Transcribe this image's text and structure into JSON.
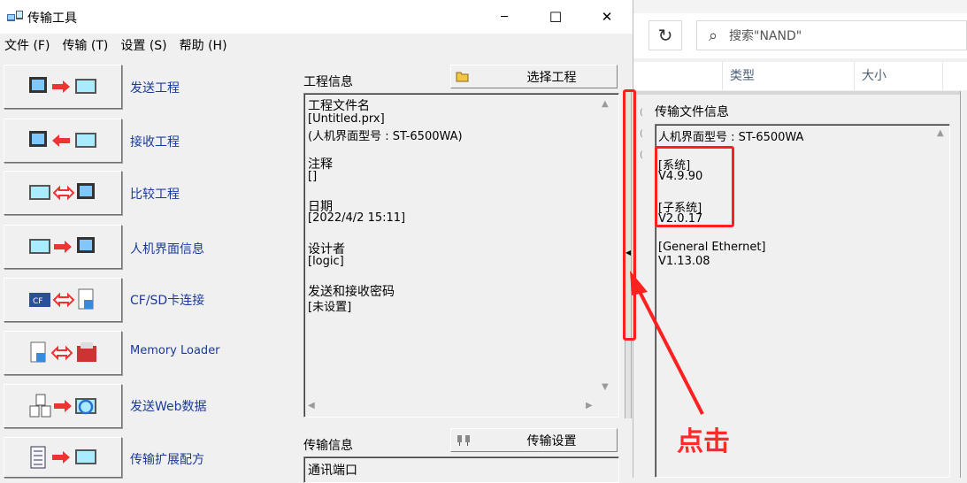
{
  "window": {
    "title": "传输工具",
    "minimize": "─",
    "maximize": "☐",
    "close": "✕"
  },
  "menu": [
    {
      "label": "文件 (F)"
    },
    {
      "label": "传输 (T)"
    },
    {
      "label": "设置 (S)"
    },
    {
      "label": "帮助 (H)"
    }
  ],
  "transfer_buttons": [
    {
      "label": "发送工程",
      "icon": "send-project-icon"
    },
    {
      "label": "接收工程",
      "icon": "receive-project-icon"
    },
    {
      "label": "比较工程",
      "icon": "compare-project-icon"
    },
    {
      "label": "人机界面信息",
      "icon": "hmi-info-icon"
    },
    {
      "label": "CF/SD卡连接",
      "icon": "cf-sd-card-icon"
    },
    {
      "label": "Memory Loader",
      "icon": "memory-loader-icon"
    },
    {
      "label": "发送Web数据",
      "icon": "send-web-data-icon"
    },
    {
      "label": "传输扩展配方",
      "icon": "transfer-recipe-icon"
    }
  ],
  "project_info": {
    "label": "工程信息",
    "select_button": "选择工程",
    "lines": [
      "工程文件名",
      " [Untitled.prx]",
      " (人机界面型号 : ST-6500WA)",
      "",
      "注释",
      " []",
      "",
      "日期",
      " [2022/4/2 15:11]",
      "",
      "设计者",
      " [logic]",
      "",
      "发送和接收密码",
      " [未设置]"
    ]
  },
  "transfer_info": {
    "label": "传输信息",
    "settings_button": "传输设置",
    "first_line": "通讯端口"
  },
  "explorer": {
    "search_placeholder": "搜索\"NAND\"",
    "columns": {
      "type": "类型",
      "size": "大小"
    }
  },
  "file_info": {
    "label": "传输文件信息",
    "lines": [
      "人机界面型号 : ST-6500WA",
      "",
      "[系统]",
      "  V4.9.90",
      "",
      "[子系统]",
      "  V2.0.17",
      "",
      "[General Ethernet]",
      "  V1.13.08"
    ]
  },
  "annotation": {
    "text": "点击",
    "color": "#ff2020"
  }
}
